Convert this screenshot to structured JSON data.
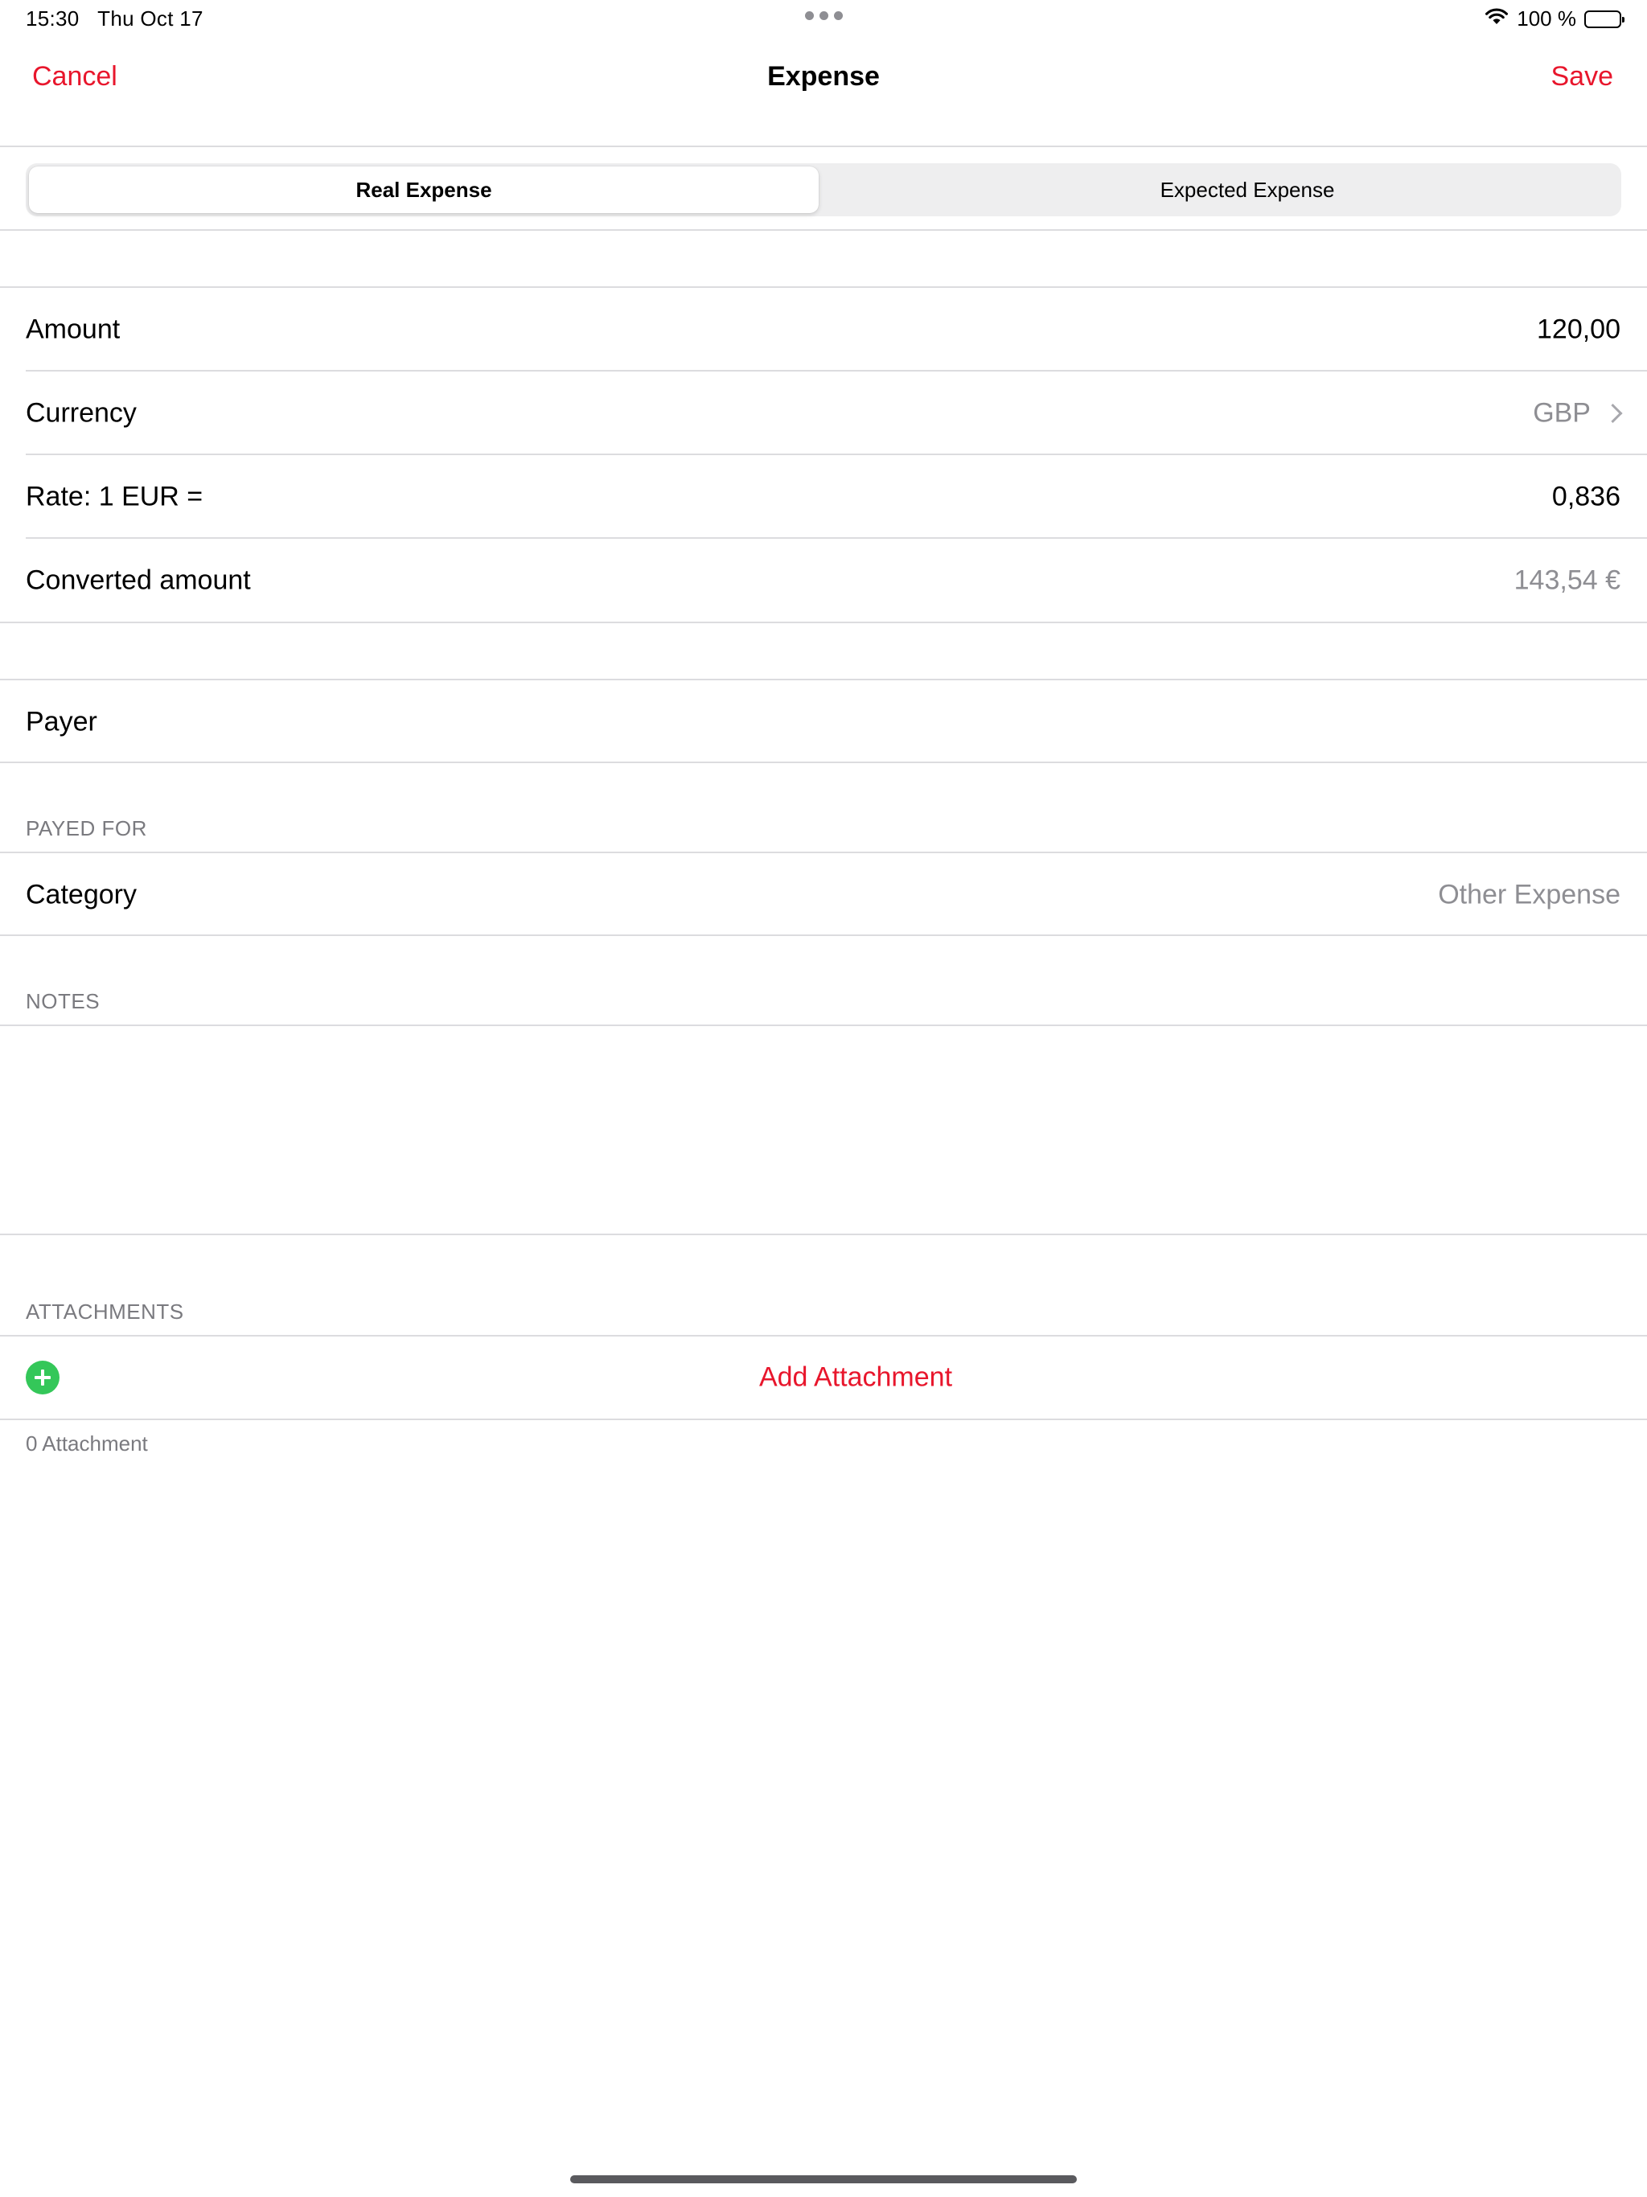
{
  "status_bar": {
    "time": "15:30",
    "date": "Thu Oct 17",
    "battery": "100 %"
  },
  "nav": {
    "cancel": "Cancel",
    "title": "Expense",
    "save": "Save"
  },
  "segments": {
    "real": "Real Expense",
    "expected": "Expected Expense",
    "selected": "Real Expense"
  },
  "fields": {
    "amount": {
      "label": "Amount",
      "value": "120,00"
    },
    "currency": {
      "label": "Currency",
      "value": "GBP"
    },
    "rate": {
      "label": "Rate: 1 EUR =",
      "value": "0,836"
    },
    "converted": {
      "label": "Converted amount",
      "value": "143,54 €"
    },
    "payer": {
      "label": "Payer"
    },
    "category": {
      "label": "Category",
      "value": "Other Expense"
    }
  },
  "sections": {
    "payed_for": "PAYED FOR",
    "notes": "NOTES",
    "attachments": "ATTACHMENTS"
  },
  "attachments": {
    "add_label": "Add Attachment",
    "count_text": "0 Attachment"
  },
  "colors": {
    "accent": "#e8162c",
    "add_icon": "#34c759",
    "secondary_text": "#8e8e93",
    "separator": "#dcdcdf"
  },
  "icons": [
    "wifi-icon",
    "battery-icon",
    "chevron-right-icon",
    "add-circle-icon"
  ]
}
